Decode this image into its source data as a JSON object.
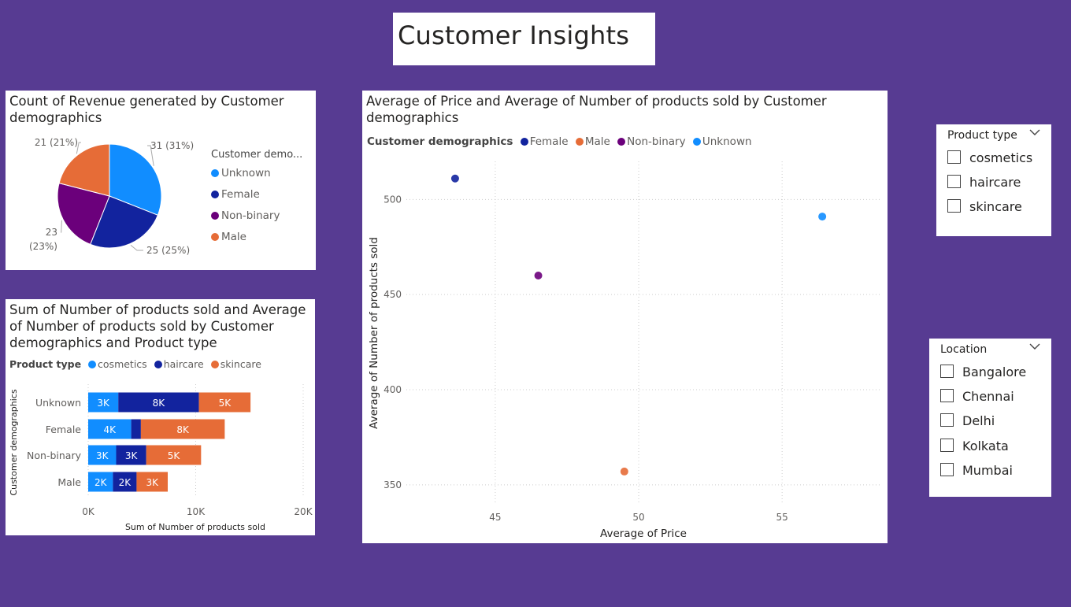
{
  "page_title": "Customer Insights",
  "colors": {
    "background": "#573b92",
    "unknown": "#118dff",
    "female": "#12239e",
    "non_binary": "#6b007b",
    "male": "#e66c37",
    "cosmetics": "#118dff",
    "haircare": "#12239e",
    "skincare": "#e66c37"
  },
  "pie": {
    "title": "Count of Revenue generated by Customer demographics",
    "legend_title": "Customer demo...",
    "legend": [
      "Unknown",
      "Female",
      "Non-binary",
      "Male"
    ],
    "labels": [
      "31 (31%)",
      "25 (25%)",
      "23 (23%)",
      "21 (21%)"
    ]
  },
  "bar": {
    "title": "Sum of Number of products sold and Average of Number of products sold by Customer demographics and Product type",
    "legend_title": "Product type",
    "legend": [
      "cosmetics",
      "haircare",
      "skincare"
    ],
    "y_axis_title": "Customer demographics",
    "x_axis_title": "Sum of Number of products sold"
  },
  "scatter": {
    "title": "Average of Price and Average of Number of products sold by Customer demographics",
    "legend_title": "Customer demographics",
    "legend": [
      "Female",
      "Male",
      "Non-binary",
      "Unknown"
    ],
    "x_axis_title": "Average of Price",
    "y_axis_title": "Average of Number of products sold"
  },
  "slicer_product": {
    "title": "Product type",
    "options": [
      "cosmetics",
      "haircare",
      "skincare"
    ]
  },
  "slicer_location": {
    "title": "Location",
    "options": [
      "Bangalore",
      "Chennai",
      "Delhi",
      "Kolkata",
      "Mumbai"
    ]
  },
  "chart_data": [
    {
      "type": "pie",
      "title": "Count of Revenue generated by Customer demographics",
      "legend_title": "Customer demo...",
      "slices": [
        {
          "name": "Unknown",
          "value": 31,
          "label": "31 (31%)",
          "color": "#118dff"
        },
        {
          "name": "Female",
          "value": 25,
          "label": "25 (25%)",
          "color": "#12239e"
        },
        {
          "name": "Non-binary",
          "value": 23,
          "label": "23 (23%)",
          "color": "#6b007b"
        },
        {
          "name": "Male",
          "value": 21,
          "label": "21 (21%)",
          "color": "#e66c37"
        }
      ]
    },
    {
      "type": "bar",
      "orientation": "horizontal-stacked",
      "title": "Sum of Number of products sold and Average of Number of products sold by Customer demographics and Product type",
      "categories": [
        "Unknown",
        "Female",
        "Non-binary",
        "Male"
      ],
      "series": [
        {
          "name": "cosmetics",
          "values": [
            2800,
            4000,
            2600,
            2300
          ],
          "labels": [
            "3K",
            "4K",
            "3K",
            "2K"
          ],
          "color": "#118dff"
        },
        {
          "name": "haircare",
          "values": [
            7500,
            900,
            2800,
            2200
          ],
          "labels": [
            "8K",
            "",
            "3K",
            "2K"
          ],
          "color": "#12239e"
        },
        {
          "name": "skincare",
          "values": [
            4800,
            7800,
            5100,
            2900
          ],
          "labels": [
            "5K",
            "8K",
            "5K",
            "3K"
          ],
          "color": "#e66c37"
        }
      ],
      "xlabel": "Sum of Number of products sold",
      "ylabel": "Customer demographics",
      "xlim": [
        0,
        20000
      ],
      "xticks": [
        "0K",
        "10K",
        "20K"
      ],
      "grid": true,
      "legend": "top"
    },
    {
      "type": "scatter",
      "title": "Average of Price and Average of Number of products sold by Customer demographics",
      "series": [
        {
          "name": "Female",
          "x": 43.6,
          "y": 511,
          "color": "#12239e"
        },
        {
          "name": "Male",
          "x": 49.5,
          "y": 357,
          "color": "#e66c37"
        },
        {
          "name": "Non-binary",
          "x": 46.5,
          "y": 460,
          "color": "#6b007b"
        },
        {
          "name": "Unknown",
          "x": 56.4,
          "y": 491,
          "color": "#118dff"
        }
      ],
      "xlabel": "Average of Price",
      "ylabel": "Average of Number of products sold",
      "xlim": [
        41.9,
        58.4
      ],
      "ylim": [
        340,
        520
      ],
      "xticks": [
        45,
        50,
        55
      ],
      "yticks": [
        350,
        400,
        450,
        500
      ],
      "grid": true,
      "legend": "top-left"
    }
  ]
}
